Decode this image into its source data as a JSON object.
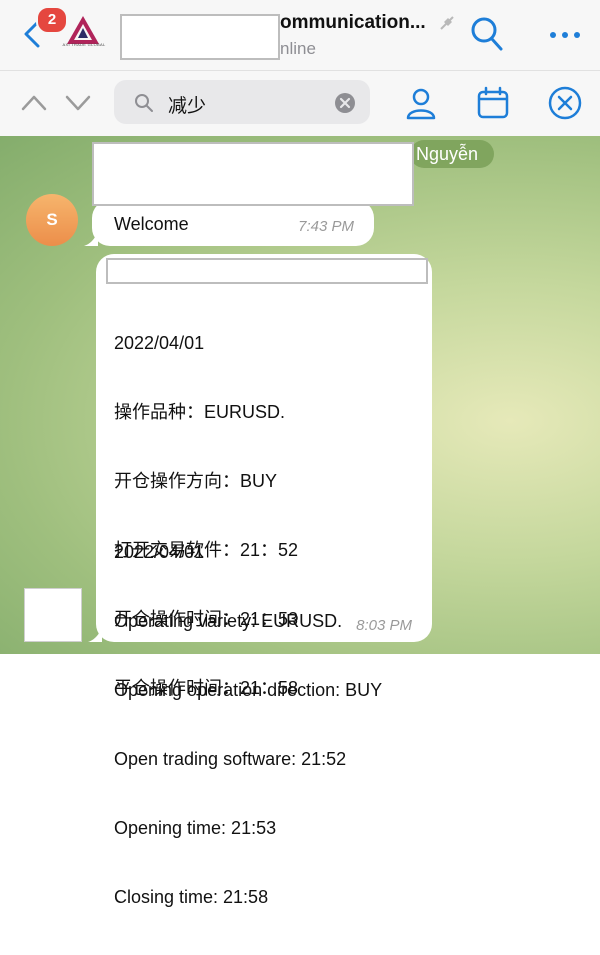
{
  "header": {
    "unread_badge": "2",
    "title": "ommunication...",
    "status": "nline",
    "logo_sub": "AXI TRADE GLOBAL"
  },
  "search": {
    "query": "减少"
  },
  "chat": {
    "sender_name": "Nguyễn",
    "avatar_initial": "S",
    "messages": [
      {
        "text": "Welcome",
        "time": "7:43 PM"
      },
      {
        "lines_cn": [
          "2022/04/01",
          "操作品种：EURUSD.",
          "开仓操作方向：BUY",
          "打开交易软件：21：52",
          "开仓操作时间：21：53",
          "平仓操作时间：21：58"
        ],
        "lines_en": [
          "2022/04/01",
          "Operating variety: EURUSD.",
          "Opening operation direction: BUY",
          "Open trading software: 21:52",
          "Opening time: 21:53",
          "Closing time: 21:58"
        ],
        "time": "8:03 PM"
      }
    ]
  },
  "colors": {
    "accent": "#1e7ed8",
    "badge": "#e5473f",
    "bubble": "#ffffff"
  },
  "icons": [
    "back-chevron-icon",
    "logo-icon",
    "mute-icon",
    "search-icon",
    "more-icon",
    "chevron-up-icon",
    "chevron-down-icon",
    "magnifier-icon",
    "clear-icon",
    "person-icon",
    "calendar-icon",
    "close-icon"
  ]
}
